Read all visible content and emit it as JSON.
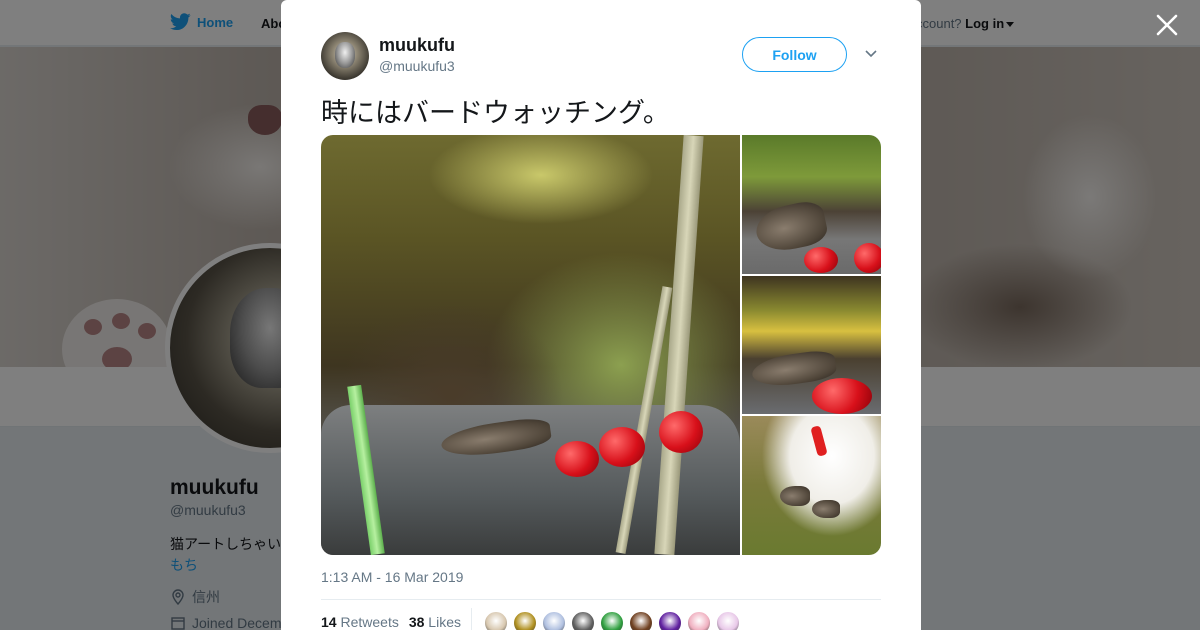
{
  "nav": {
    "home_label": "Home",
    "about_label": "Abo",
    "login_prompt": "ccount?",
    "login_label": "Log in"
  },
  "profile": {
    "name": "muukufu",
    "handle": "@muukufu3",
    "bio": "猫アートしちゃい",
    "bio_link": "もち",
    "location": "信州",
    "joined": "Joined Decem"
  },
  "tweet": {
    "author_name": "muukufu",
    "author_handle": "@muukufu3",
    "follow_label": "Follow",
    "text": "時にはバードウォッチング。",
    "timestamp": "1:13 AM - 16 Mar 2019",
    "retweets_count": "14",
    "retweets_label": "Retweets",
    "likes_count": "38",
    "likes_label": "Likes"
  },
  "media": [
    {
      "alt": "photo-main",
      "subject": "bird eating apple on rock"
    },
    {
      "alt": "photo-2",
      "subject": "bird with open beak"
    },
    {
      "alt": "photo-3",
      "subject": "bird pecking apple"
    },
    {
      "alt": "photo-4",
      "subject": "cat with red collar and sparrows"
    }
  ],
  "likers": [
    {
      "color": "#d8c8b0"
    },
    {
      "color": "#b09020"
    },
    {
      "color": "#b0c0e0"
    },
    {
      "color": "#606060"
    },
    {
      "color": "#30a040"
    },
    {
      "color": "#704020"
    },
    {
      "color": "#6020a0"
    },
    {
      "color": "#f0b0c0"
    },
    {
      "color": "#e8c8e8"
    }
  ],
  "icons": {
    "brand": "twitter-bird-icon",
    "close": "close-icon",
    "caret": "chevron-down-icon",
    "location": "location-pin-icon",
    "calendar": "calendar-icon"
  },
  "colors": {
    "accent": "#1da1f2",
    "text": "#14171a",
    "muted": "#657786"
  }
}
